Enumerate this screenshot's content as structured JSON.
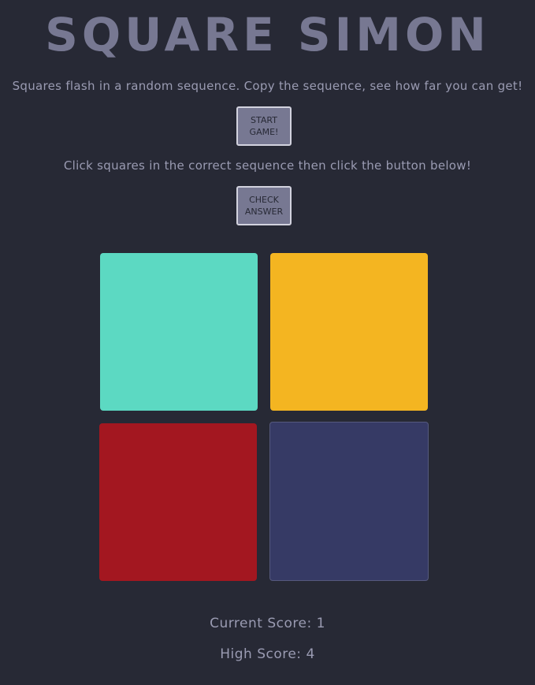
{
  "title": "Square Simon",
  "instructions": {
    "intro": "Squares flash in a random sequence. Copy the sequence, see how far you can get!",
    "play": "Click squares in the correct sequence then click the button below!"
  },
  "buttons": {
    "start": "Start Game!",
    "check": "Check Answer"
  },
  "squares": [
    {
      "name": "teal",
      "color": "#5cd9c2"
    },
    {
      "name": "yellow",
      "color": "#f4b521"
    },
    {
      "name": "red",
      "color": "#a31720"
    },
    {
      "name": "navy",
      "color": "#363a65"
    }
  ],
  "score": {
    "current": "Current Score: 1",
    "high": "High Score: 4"
  },
  "colors": {
    "background": "#272935",
    "title": "#777892",
    "text": "#9a9bb2",
    "button_bg": "#777892",
    "button_border": "#d2d2de"
  }
}
